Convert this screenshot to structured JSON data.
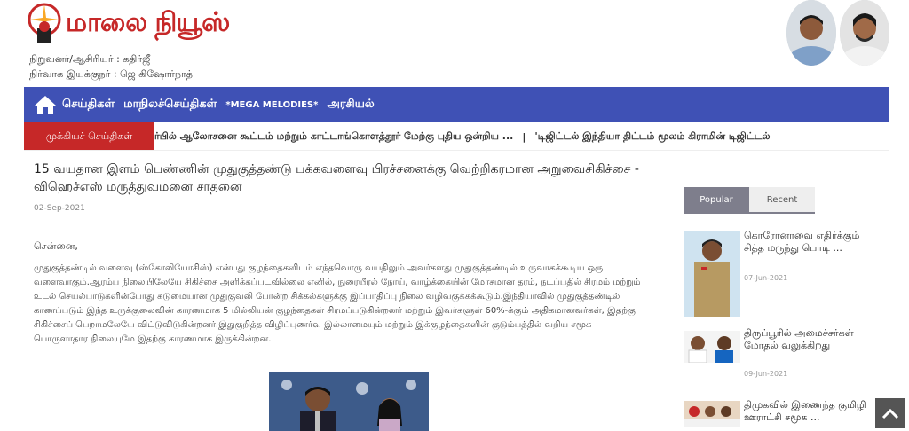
{
  "site": {
    "logo_text": "மாலை நியூஸ்",
    "founder_line": "நிறுவனர்/ஆசிரியர் : கதிர்ஜீ",
    "admin_line": "நிர்வாக இயக்குநர் : ஜெ கிஷோர்நாத்"
  },
  "nav": {
    "items": [
      "செய்திகள்",
      "மாநிலச்செய்திகள்",
      "*MEGA MELODIES*",
      "அரசியல்"
    ]
  },
  "ticker": {
    "label": "முக்கியச் செய்திகள்",
    "items": [
      "ர்பில் ஆலோசனை கூட்டம் மற்றும் காட்டாங்கொளத்தூர் மேற்கு புதிய ஒன்றிய ...",
      "'டிஜிட்டல் இந்தியா திட்டம் மூலம் கிராமின் டிஜிட்டல்"
    ],
    "separator": "|"
  },
  "article": {
    "headline": "15 வயதான இளம் பெண்ணின் முதுகுத்தண்டு பக்கவளைவு பிரச்சனைக்கு வெற்றிகரமான அறுவைசிகிச்சை - விஹெச்எஸ் மருத்துவமனை சாதனை",
    "date": "02-Sep-2021",
    "city": "சென்னை,",
    "body": "முதுகுத்தண்டில் வளைவு (ஸ்கோலியோசிஸ்) என்பது குழந்தைகளிடம் எந்தவொரு வயதிலும் அவர்களது முதுகுத்தண்டில் உருவாகக்கூடிய ஒரு வளைவாகும்.ஆரம்ப நிலையிலேயே சிகிச்சை அளிக்கப்படவில்லை எனில், நுரையீரல் நோய், வாழ்க்கையின் மோசமான தரம், நடப்பதில் சிரமம் மற்றும் உடல் செயல்பாடுகளின்போது கடுமையான முதுகுவலி போன்ற சிக்கல்களுக்கு இப்பாதிப்பு நிலை வழிவகுக்கக்கூடும்.இந்தியாவில் முதுகுத்தண்டில் காணப்படும் இந்த உருக்குலைவின் காரணமாக 5 மில்லியன் குழந்தைகள் சிரமப்படுகின்றனர் மற்றும் இவர்களுள் 60%-க்கும் அதிகமானவர்கள், இதற்கு சிகிச்சைப் பெறாமலேயே விட்டுவிடுகின்றனர்.இதுகுறித்த விழிப்புணர்வு இல்லாமையும் மற்றும் இக்குழந்தைகளின் குடும்பத்தில் வறிய சமூக பொருளாதார நிலையுமே இதற்கு காரணமாக இருக்கின்றன."
  },
  "sidebar": {
    "tabs": [
      "Popular",
      "Recent"
    ],
    "items": [
      {
        "title": "கொரோனாவை எதிர்க்கும் சித்த மருந்து பொடி ...",
        "date": "07-Jun-2021"
      },
      {
        "title": "திருப்பூரில் அமைச்சர்கள் மோதல் வலுக்கிறது",
        "date": "09-Jun-2021"
      },
      {
        "title": "திமுகவில் இணைந்த குமிழி ஊராட்சி சமூக ...",
        "date": ""
      }
    ]
  }
}
